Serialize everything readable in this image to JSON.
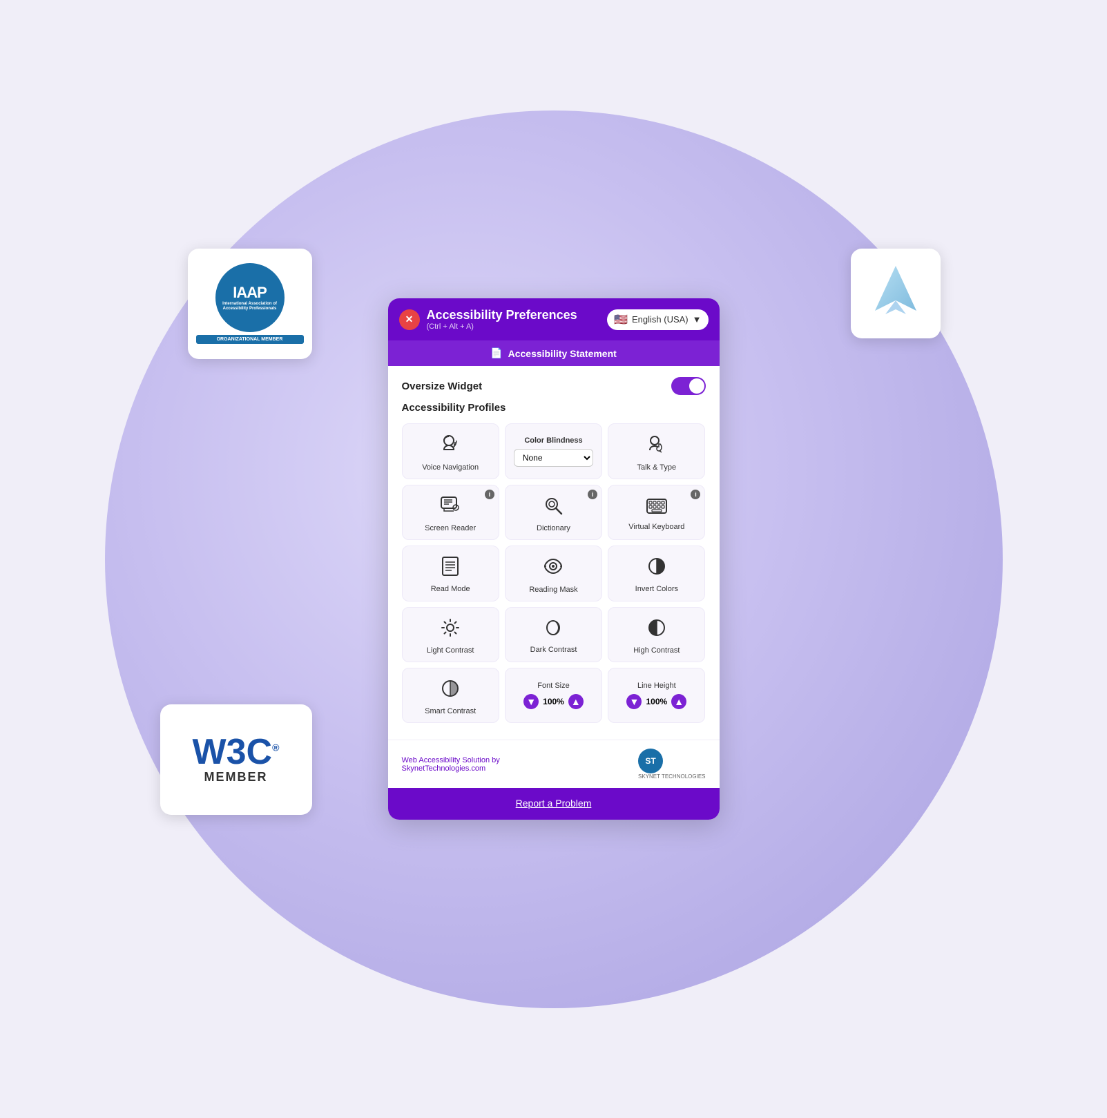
{
  "header": {
    "title": "Accessibility Preferences",
    "subtitle": "(Ctrl + Alt + A)",
    "close_label": "✕",
    "lang_label": "English (USA)"
  },
  "stmt_bar": {
    "label": "Accessibility Statement",
    "icon": "📄"
  },
  "oversize_widget": {
    "label": "Oversize Widget"
  },
  "profiles": {
    "label": "Accessibility Profiles"
  },
  "features": {
    "row1": [
      {
        "id": "voice-navigation",
        "icon": "🗣",
        "label": "Voice Navigation"
      },
      {
        "id": "color-blindness",
        "icon": "cb",
        "label": "Color Blindness",
        "type": "select",
        "options": [
          "None"
        ]
      },
      {
        "id": "talk-type",
        "icon": "💬",
        "label": "Talk & Type"
      }
    ],
    "row2": [
      {
        "id": "screen-reader",
        "icon": "📺",
        "label": "Screen Reader",
        "info": true
      },
      {
        "id": "dictionary",
        "icon": "🔍",
        "label": "Dictionary",
        "info": true
      },
      {
        "id": "virtual-keyboard",
        "icon": "⌨",
        "label": "Virtual Keyboard",
        "info": true
      }
    ],
    "row3": [
      {
        "id": "read-mode",
        "icon": "📋",
        "label": "Read Mode"
      },
      {
        "id": "reading-mask",
        "icon": "🎭",
        "label": "Reading Mask"
      },
      {
        "id": "invert-colors",
        "icon": "◑",
        "label": "Invert Colors"
      }
    ],
    "row4": [
      {
        "id": "light-contrast",
        "icon": "☀",
        "label": "Light Contrast"
      },
      {
        "id": "dark-contrast",
        "icon": "🌙",
        "label": "Dark Contrast"
      },
      {
        "id": "high-contrast",
        "icon": "◐",
        "label": "High Contrast"
      }
    ],
    "row5_left": {
      "id": "smart-contrast",
      "icon": "◑",
      "label": "Smart Contrast"
    },
    "row5_mid": {
      "id": "font-size",
      "label": "Font Size",
      "value": "100%"
    },
    "row5_right": {
      "id": "line-height",
      "label": "Line Height",
      "value": "100%"
    }
  },
  "footer": {
    "text1": "Web Accessibility Solution by",
    "text2": "SkynetTechnologies.com",
    "logo_text": "ST",
    "brand": "SKYNET TECHNOLOGIES"
  },
  "report": {
    "label": "Report a Problem"
  },
  "iaap": {
    "large": "IAAP",
    "small": "International Association\nof Accessibility Professionals",
    "org": "ORGANIZATIONAL\nMEMBER"
  },
  "w3c": {
    "logo": "W3C",
    "registered": "®",
    "member": "MEMBER"
  },
  "colors": {
    "primary": "#6b0ac9",
    "secondary": "#7c22d4"
  }
}
